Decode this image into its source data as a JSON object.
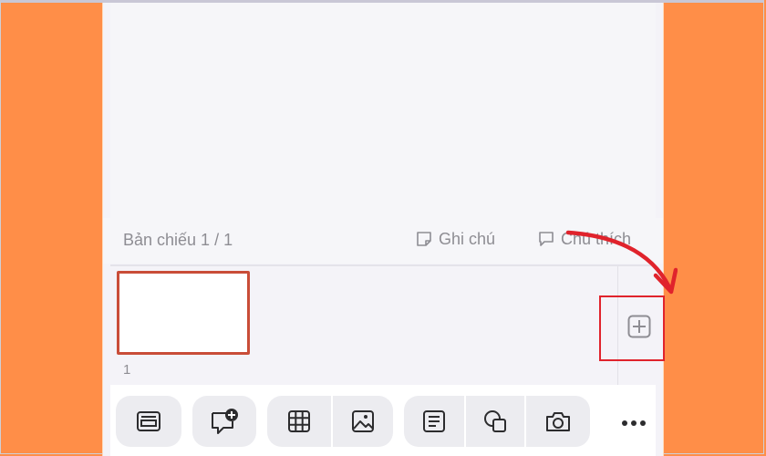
{
  "slide_panel": {
    "slide_count_label": "Bản chiếu 1 / 1",
    "notes_label": "Ghi chú",
    "comments_label": "Chú thích"
  },
  "thumbnails": [
    {
      "number": "1",
      "selected": true
    }
  ],
  "annotation": {
    "arrow_color": "#e0232c",
    "highlight_color": "#e0232c"
  },
  "toolbar": {
    "items": [
      {
        "icon": "slide-layout-icon"
      },
      {
        "icon": "add-comment-icon"
      },
      {
        "icon": "table-icon"
      },
      {
        "icon": "image-icon"
      },
      {
        "icon": "text-box-icon"
      },
      {
        "icon": "shapes-icon"
      },
      {
        "icon": "camera-icon"
      },
      {
        "icon": "more-icon"
      }
    ]
  },
  "colors": {
    "background_orange": "#ff8e48",
    "panel_bg": "#f4f3f8",
    "selection_border": "#c94d38",
    "icon_gray": "#8e8d93"
  }
}
